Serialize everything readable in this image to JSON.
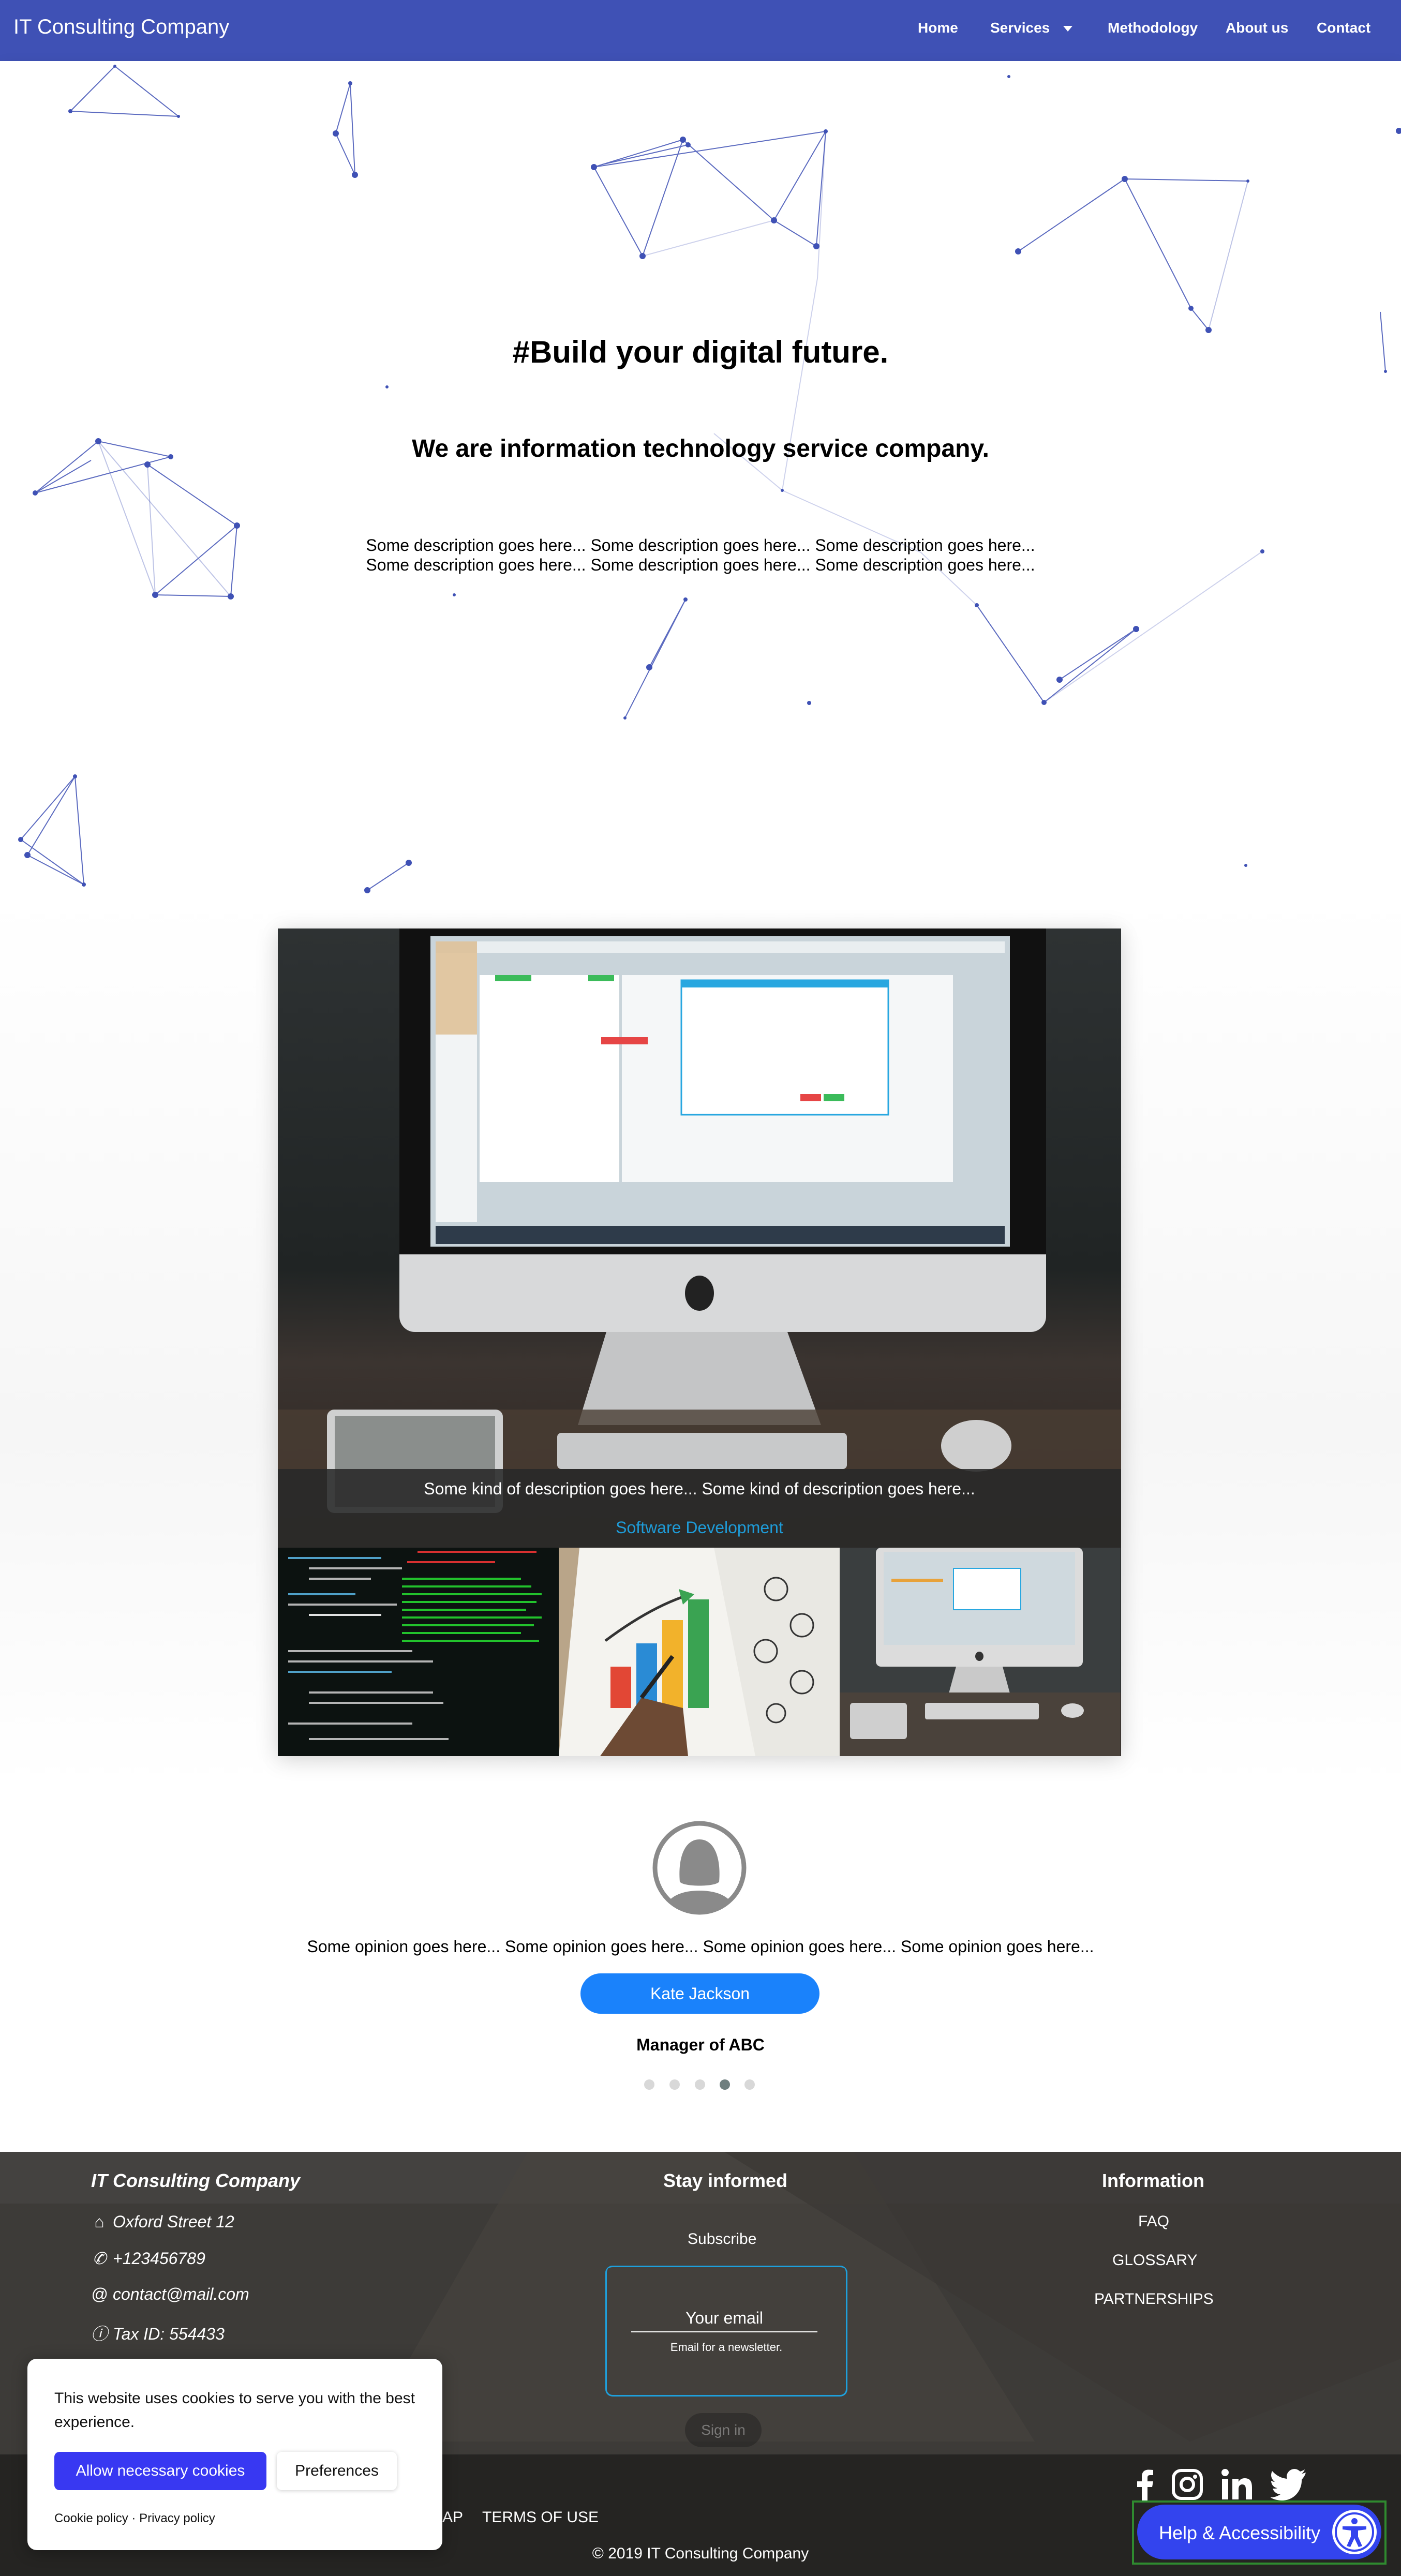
{
  "nav": {
    "brand": "IT Consulting Company",
    "links": [
      "Home",
      "Services",
      "Methodology",
      "About us",
      "Contact"
    ]
  },
  "hero": {
    "title": "#Build your digital future.",
    "subtitle": "We are information technology service company.",
    "description_lines": [
      "Some description goes here... Some description goes here... Some description goes here...",
      "Some description goes here... Some description goes here... Some description goes here..."
    ]
  },
  "gallery": {
    "caption": "Some kind of description goes here... Some kind of description goes here...",
    "tag": "Software Development",
    "thumbnails": [
      "code-screen",
      "chart-notebook",
      "imac-desk"
    ]
  },
  "testimonial": {
    "opinion": "Some opinion goes here... Some opinion goes here... Some opinion goes here... Some opinion goes here...",
    "name": "Kate Jackson",
    "role": "Manager of ABC",
    "dots_total": 5,
    "active_dot": 4
  },
  "footer": {
    "company": "IT Consulting Company",
    "address": "Oxford Street 12",
    "phone": "+123456789",
    "email": "contact@mail.com",
    "tax": "Tax ID: 554433",
    "stay_informed": "Stay informed",
    "subscribe": "Subscribe",
    "email_placeholder": "Your email",
    "email_help": "Email for a newsletter.",
    "signin": "Sign in",
    "information": "Information",
    "info_links": [
      "FAQ",
      "GLOSSARY",
      "PARTNERSHIPS"
    ],
    "bottom_links": [
      "AP",
      "TERMS OF USE"
    ],
    "copyright": "© 2019 IT Consulting Company",
    "help": "Help & Accessibility",
    "social": [
      "facebook-icon",
      "instagram-icon",
      "linkedin-icon",
      "twitter-icon"
    ]
  },
  "cookie": {
    "text": "This website uses cookies to serve you with the best experience.",
    "allow": "Allow necessary cookies",
    "preferences": "Preferences",
    "policy": "Cookie policy",
    "separator": " · ",
    "privacy": "Privacy policy"
  },
  "colors": {
    "nav": "#3f51b5",
    "network": "#3f51b5",
    "accent_blue": "#1a82fb",
    "footer": "#3d3b38",
    "footer_bottom": "#252422",
    "help_button": "#3344ee",
    "cookie_button": "#3838f2"
  }
}
